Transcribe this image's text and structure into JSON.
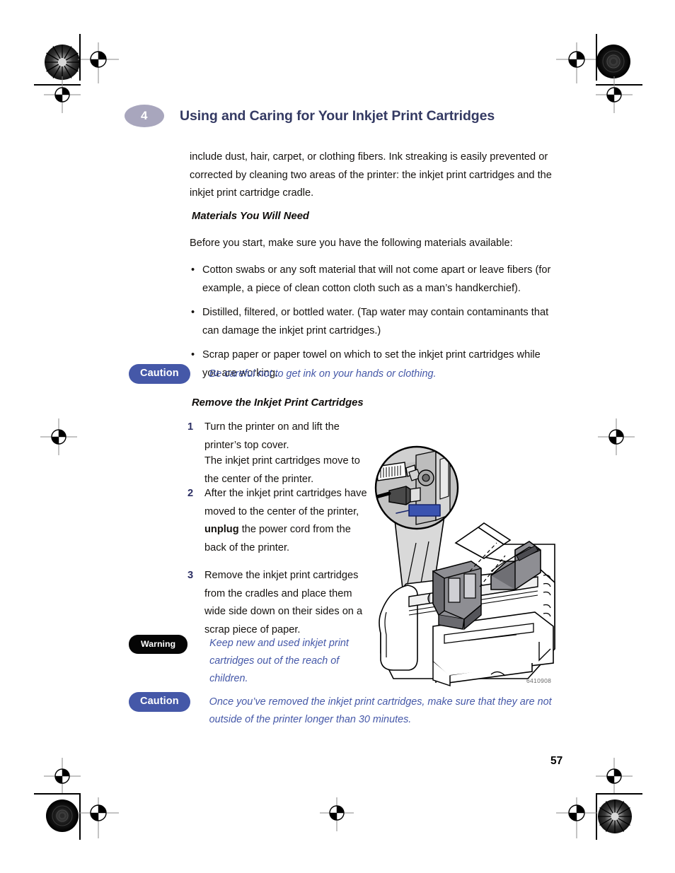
{
  "chapter": {
    "number": "4",
    "title": "Using and Caring for Your Inkjet Print Cartridges"
  },
  "content": {
    "intro_paragraph": "include dust, hair, carpet, or clothing fibers. Ink streaking is easily prevented or corrected by cleaning two areas of the printer: the inkjet print cartridges and the inkjet print cartridge cradle.",
    "materials_heading": "Materials You Will Need",
    "materials_intro": "Before you start, make sure you have the following materials available:",
    "bullet_marker": "•",
    "materials_list": [
      "Cotton swabs or any soft material that will not come apart or leave fibers (for example, a piece of clean cotton cloth such as a man’s handkerchief).",
      "Distilled, filtered, or bottled water. (Tap water may contain contaminants that can damage the inkjet print cartridges.)",
      "Scrap paper or paper towel on which to set the inkjet print cartridges while you are working."
    ],
    "remove_heading": "Remove the Inkjet Print Cartridges",
    "steps": [
      {
        "number": "1",
        "text": "Turn the printer on and lift the printer’s top cover."
      },
      {
        "number": "2",
        "text_before_bold": "After the inkjet print cartridges have moved to the center of the printer, ",
        "bold": "unplug",
        "text_after_bold": " the power cord from the back of the printer."
      },
      {
        "number": "3",
        "text": "Remove the inkjet print cartridges from the cradles and place them wide side down on their sides on a scrap piece of paper."
      }
    ],
    "step1_note": "The inkjet print cartridges move to the center of the printer."
  },
  "callouts": {
    "caution_label": "Caution",
    "warning_label": "Warning",
    "caution_1_text": "Be careful not to get ink on your hands or clothing.",
    "warning_1_text": "Keep new and used inkjet print cartridges out of the reach of children.",
    "caution_2_text": "Once you’ve removed the inkjet print cartridges, make sure that they are not outside of the printer longer than 30 minutes."
  },
  "figure": {
    "id": "6410908",
    "description": "Printer with top cover open, inkjet print cartridges in cradle, magnified callout of rear power cord connection with blue arrow"
  },
  "footer": {
    "page_number": "57"
  },
  "colors": {
    "chapter_title": "#343a63",
    "chapter_badge": "#a8a6bd",
    "caution_badge": "#4558a8",
    "warning_badge": "#050505",
    "callout_text": "#4558a8",
    "step_number": "#2c2f64",
    "arrow_blue": "#3a53b0"
  }
}
